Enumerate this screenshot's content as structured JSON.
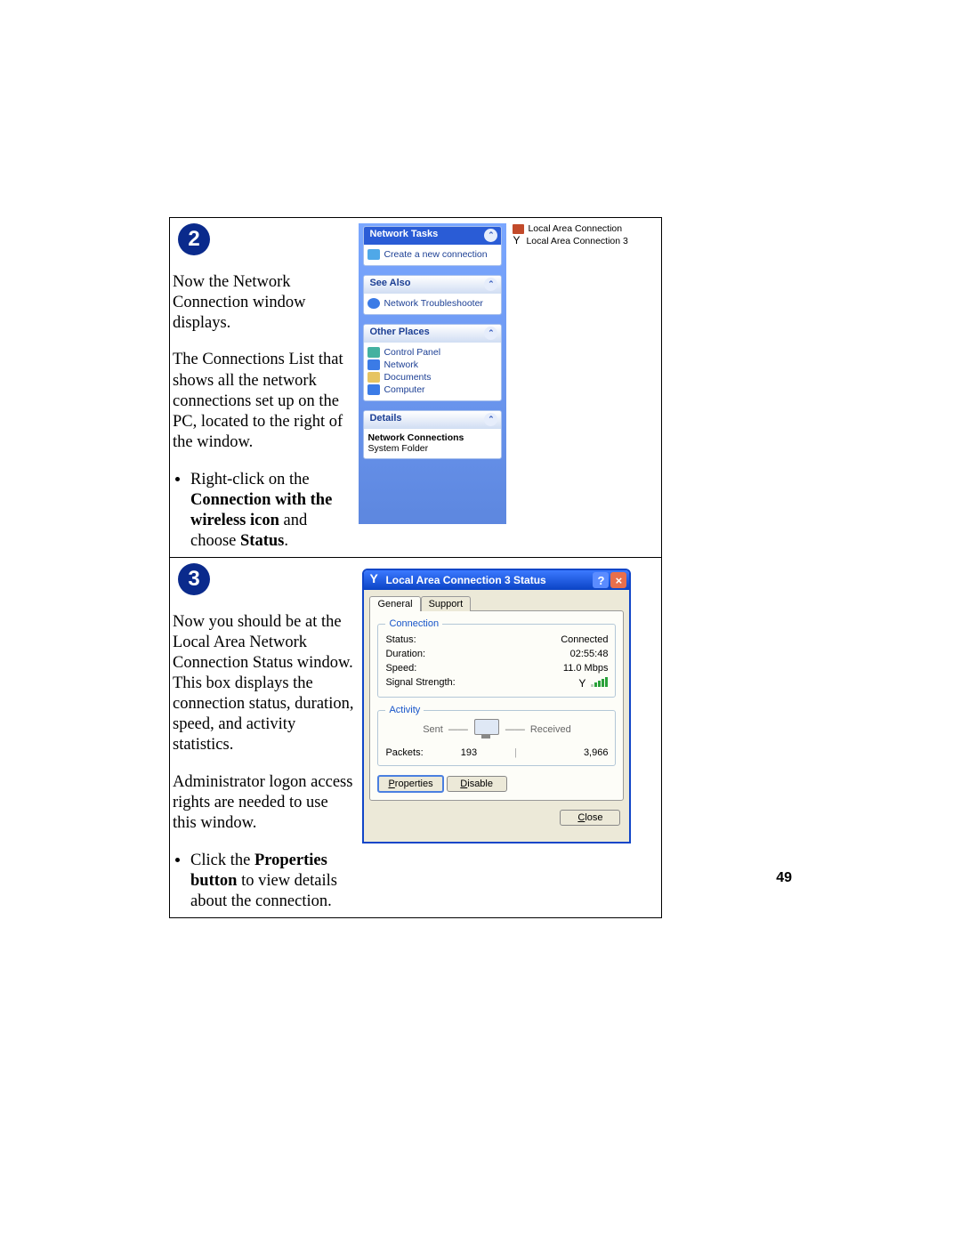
{
  "page_number": "49",
  "step2": {
    "num": "2",
    "p1": "Now the Network Connection window displays.",
    "p2": "The Connections List that shows all the network connections set up on the PC, located to the right of the window.",
    "bullet_pre": "Right-click on the ",
    "bullet_bold1": "Connection with the wireless icon",
    "bullet_mid": " and choose ",
    "bullet_bold2": "Status",
    "bullet_post": "."
  },
  "step3": {
    "num": "3",
    "p1": "Now you should be at the Local Area Network Connection Status window. This box displays the connection status, duration, speed, and activity statistics.",
    "p2": "Administrator logon access rights are needed to use this window.",
    "bullet_pre": "Click the ",
    "bullet_bold": "Properties button",
    "bullet_post": " to view details about the connection."
  },
  "sidebar": {
    "tasks": {
      "title": "Network Tasks",
      "item1": "Create a new connection"
    },
    "seealso": {
      "title": "See Also",
      "item1": "Network Troubleshooter"
    },
    "other": {
      "title": "Other Places",
      "ctrl": "Control Panel",
      "net": "Network",
      "docs": "Documents",
      "comp": "Computer"
    },
    "details": {
      "title": "Details",
      "line1": "Network Connections",
      "line2": "System Folder"
    }
  },
  "connections": {
    "c1": "Local Area Connection",
    "c2": "Local Area Connection 3"
  },
  "dialog": {
    "title": "Local Area Connection 3 Status",
    "tab_general": "General",
    "tab_support": "Support",
    "grp_conn": "Connection",
    "status_l": "Status:",
    "status_v": "Connected",
    "duration_l": "Duration:",
    "duration_v": "02:55:48",
    "speed_l": "Speed:",
    "speed_v": "11.0 Mbps",
    "signal_l": "Signal Strength:",
    "grp_act": "Activity",
    "sent": "Sent",
    "recv": "Received",
    "packets_l": "Packets:",
    "packets_sent": "193",
    "packets_recv": "3,966",
    "btn_props": "Properties",
    "btn_disable": "Disable",
    "btn_close": "Close"
  }
}
